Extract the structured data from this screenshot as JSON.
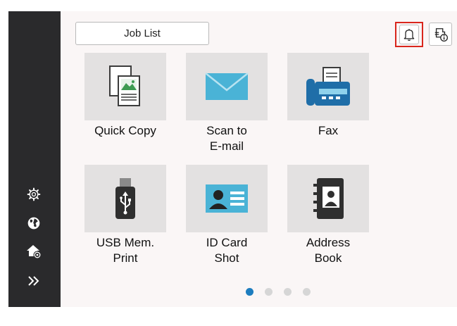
{
  "header": {
    "job_list_label": "Job List"
  },
  "tiles": [
    {
      "label": "Quick Copy",
      "icon": "copy-icon"
    },
    {
      "label": "Scan to\nE-mail",
      "icon": "email-icon"
    },
    {
      "label": "Fax",
      "icon": "fax-icon"
    },
    {
      "label": "USB Mem.\nPrint",
      "icon": "usb-icon"
    },
    {
      "label": "ID Card\nShot",
      "icon": "id-card-icon"
    },
    {
      "label": "Address\nBook",
      "icon": "address-book-icon"
    }
  ],
  "sidebar": {
    "icons": [
      "gear-icon",
      "globe-icon",
      "home-settings-icon",
      "double-chevron-right-icon"
    ]
  },
  "pagination": {
    "pages": 4,
    "current": 1
  },
  "colors": {
    "sidebar": "#2a2a2c",
    "accent_blue": "#1d7dbf",
    "fax_blue": "#1f6ea8",
    "highlight_red": "#d9261c",
    "tile_bg": "#e3e1e1"
  }
}
